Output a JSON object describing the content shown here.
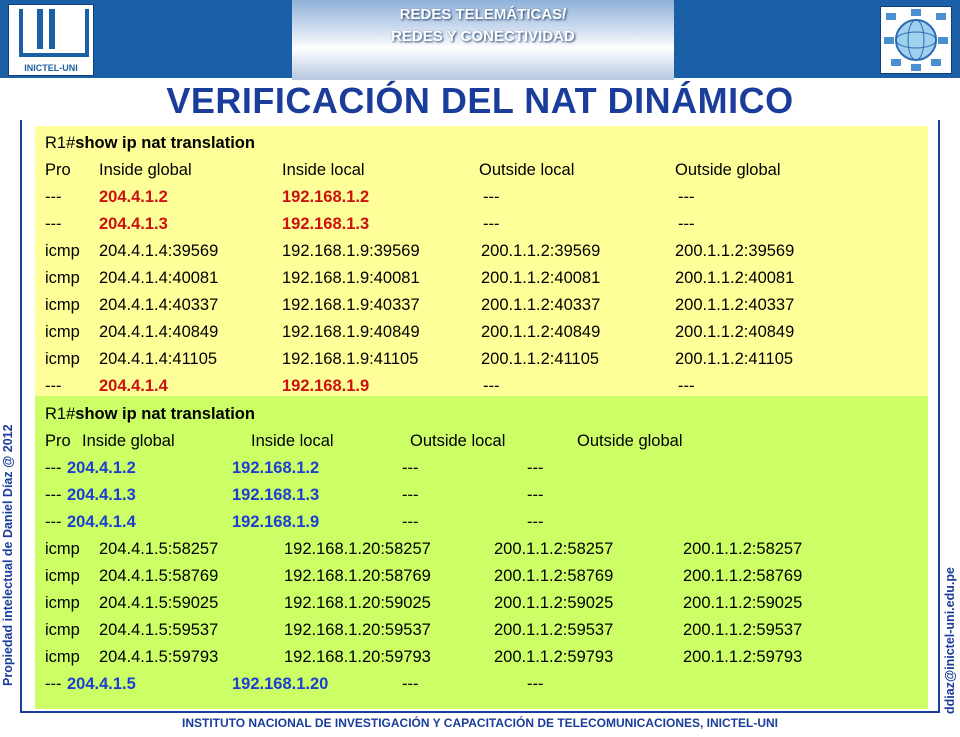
{
  "header": {
    "line1": "REDES TELEMÁTICAS/",
    "line2": "REDES Y CONECTIVIDAD",
    "logo_text": "INICTEL-UNI",
    "logo_left_icon": "inictel-uni-logo",
    "logo_right_icon": "network-globe-icon",
    "bar_color": "#1b5fa6"
  },
  "title": "VERIFICACIÓN DEL NAT DINÁMICO",
  "side_left": "Propiedad intelectual de Daniel Díaz @ 2012",
  "side_right": "ddiaz@inictel-uni.edu.pe",
  "footer": "INSTITUTO NACIONAL DE INVESTIGACIÓN Y CAPACITACIÓN DE TELECOMUNICACIONES, INICTEL-UNI",
  "colors": {
    "panel1_bg": "#ffff99",
    "panel2_bg": "#ccff66",
    "highlight1": "#cc1111",
    "highlight2": "#1c3fd1",
    "title": "#1a3c9a"
  },
  "panel1": {
    "prompt": "R1#",
    "command": "show ip nat translation",
    "headers": [
      "Pro",
      "Inside global",
      "Inside local",
      "Outside local",
      "Outside global"
    ],
    "rows": [
      [
        "---",
        "204.4.1.2",
        "192.168.1.2",
        "---",
        "---"
      ],
      [
        "---",
        "204.4.1.3",
        "192.168.1.3",
        "---",
        "---"
      ],
      [
        "icmp",
        "204.4.1.4:39569",
        "192.168.1.9:39569",
        "200.1.1.2:39569",
        "200.1.1.2:39569"
      ],
      [
        "icmp",
        "204.4.1.4:40081",
        "192.168.1.9:40081",
        "200.1.1.2:40081",
        "200.1.1.2:40081"
      ],
      [
        "icmp",
        "204.4.1.4:40337",
        "192.168.1.9:40337",
        "200.1.1.2:40337",
        "200.1.1.2:40337"
      ],
      [
        "icmp",
        "204.4.1.4:40849",
        "192.168.1.9:40849",
        "200.1.1.2:40849",
        "200.1.1.2:40849"
      ],
      [
        "icmp",
        "204.4.1.4:41105",
        "192.168.1.9:41105",
        "200.1.1.2:41105",
        "200.1.1.2:41105"
      ],
      [
        "---",
        "204.4.1.4",
        "192.168.1.9",
        "---",
        "---"
      ]
    ]
  },
  "panel2": {
    "prompt": "R1#",
    "command": "show ip nat translation",
    "headers": [
      "Pro",
      "Inside global",
      "Inside local",
      "Outside local",
      "Outside global"
    ],
    "rows": [
      [
        "---",
        "204.4.1.2",
        "192.168.1.2",
        "---",
        "---"
      ],
      [
        "---",
        "204.4.1.3",
        "192.168.1.3",
        "---",
        "---"
      ],
      [
        "---",
        "204.4.1.4",
        "192.168.1.9",
        "---",
        "---"
      ],
      [
        "icmp",
        "204.4.1.5:58257",
        "192.168.1.20:58257",
        "200.1.1.2:58257",
        "200.1.1.2:58257"
      ],
      [
        "icmp",
        "204.4.1.5:58769",
        "192.168.1.20:58769",
        "200.1.1.2:58769",
        "200.1.1.2:58769"
      ],
      [
        "icmp",
        "204.4.1.5:59025",
        "192.168.1.20:59025",
        "200.1.1.2:59025",
        "200.1.1.2:59025"
      ],
      [
        "icmp",
        "204.4.1.5:59537",
        "192.168.1.20:59537",
        "200.1.1.2:59537",
        "200.1.1.2:59537"
      ],
      [
        "icmp",
        "204.4.1.5:59793",
        "192.168.1.20:59793",
        "200.1.1.2:59793",
        "200.1.1.2:59793"
      ],
      [
        "---",
        "204.4.1.5",
        "192.168.1.20",
        "---",
        "---"
      ]
    ]
  }
}
